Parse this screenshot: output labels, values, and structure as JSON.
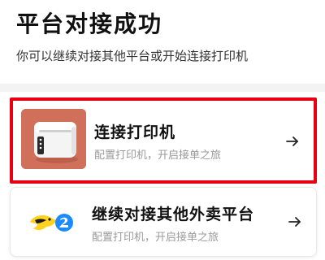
{
  "header": {
    "title": "平台对接成功",
    "subtitle": "你可以继续对接其他平台或开始连接打印机"
  },
  "options": [
    {
      "title": "连接打印机",
      "subtitle": "配置打印机，开启接单之旅",
      "icon": "printer-icon",
      "arrow_icon": "arrow-right-icon",
      "highlighted": true,
      "highlight_color": "#e60012",
      "thumb_bg": "#d0705a"
    },
    {
      "title": "继续对接其他外卖平台",
      "subtitle": "配置打印机，开启接单之旅",
      "icon": "delivery-platform-logo-icon",
      "arrow_icon": "arrow-right-icon",
      "highlighted": false
    }
  ]
}
